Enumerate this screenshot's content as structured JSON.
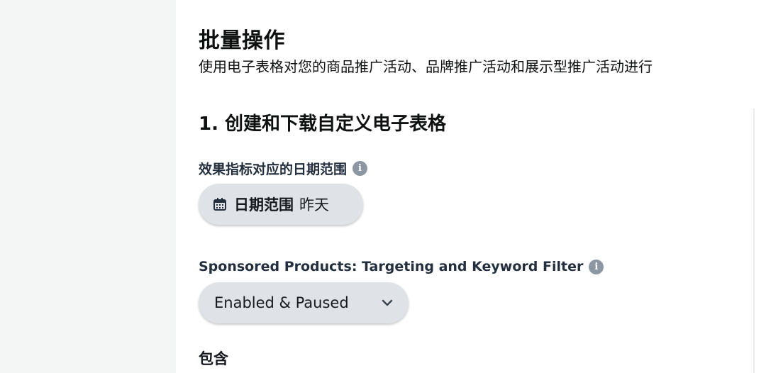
{
  "header": {
    "title": "批量操作",
    "description": "使用电子表格对您的商品推广活动、品牌推广活动和展示型推广活动进行"
  },
  "section": {
    "title": "1. 创建和下载自定义电子表格"
  },
  "date_range": {
    "label": "效果指标对应的日期范围",
    "button_label": "日期范围",
    "button_value": "昨天"
  },
  "sp_filter": {
    "label": "Sponsored Products: Targeting and Keyword Filter",
    "selected": "Enabled & Paused"
  },
  "include": {
    "label": "包含"
  },
  "icons": {
    "info": "info-icon",
    "calendar": "calendar-icon",
    "chevron": "chevron-down-icon"
  },
  "colors": {
    "pill_bg": "#dfe3e8",
    "info_icon": "#8d96a3",
    "text": "#0f1111"
  }
}
